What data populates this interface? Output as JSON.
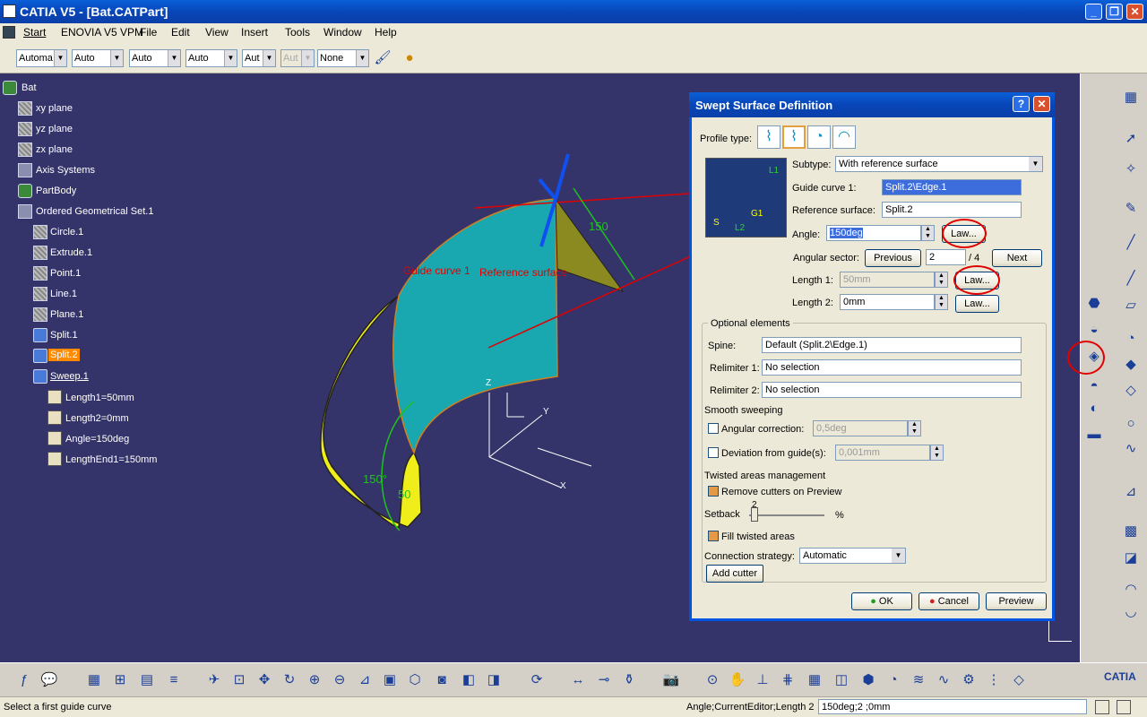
{
  "window": {
    "title": "CATIA V5 - [Bat.CATPart]"
  },
  "menu": [
    "Start",
    "ENOVIA V5 VPM",
    "File",
    "Edit",
    "View",
    "Insert",
    "Tools",
    "Window",
    "Help"
  ],
  "toolbar": {
    "combos": [
      "Automa",
      "Auto",
      "Auto",
      "Auto",
      "Aut",
      "Aut",
      "None"
    ]
  },
  "tree": {
    "root": "Bat",
    "items": [
      "xy plane",
      "yz plane",
      "zx plane",
      "Axis Systems",
      "PartBody",
      "Ordered Geometrical Set.1",
      "Circle.1",
      "Extrude.1",
      "Point.1",
      "Line.1",
      "Plane.1",
      "Split.1",
      "Split.2",
      "Sweep.1",
      "Length1=50mm",
      "Length2=0mm",
      "Angle=150deg",
      "LengthEnd1=150mm"
    ]
  },
  "viewport": {
    "annotation_150": "150",
    "label_guide": "Guide curve 1",
    "label_ref": "Reference surface",
    "angle_label": "150°",
    "len_label": "50",
    "axis_z": "Z",
    "axis_y": "Y",
    "axis_x": "X"
  },
  "dialog": {
    "title": "Swept Surface Definition",
    "help_btn": "?",
    "profile_type_label": "Profile type:",
    "subtype_label": "Subtype:",
    "subtype_value": "With reference surface",
    "guide_label": "Guide curve 1:",
    "guide_value": "Split.2\\Edge.1",
    "ref_label": "Reference surface:",
    "ref_value": "Split.2",
    "angle_label": "Angle:",
    "angle_value": "150deg",
    "law_label": "Law...",
    "sector_label": "Angular sector:",
    "previous": "Previous",
    "sector_value": "2",
    "sector_total": "/ 4",
    "next": "Next",
    "len1_label": "Length 1:",
    "len1_value": "50mm",
    "len2_label": "Length 2:",
    "len2_value": "0mm",
    "optional_title": "Optional elements",
    "spine_label": "Spine:",
    "spine_value": "Default (Split.2\\Edge.1)",
    "relim1_label": "Relimiter 1:",
    "relim1_value": "No selection",
    "relim2_label": "Relimiter 2:",
    "relim2_value": "No selection",
    "smooth_title": "Smooth sweeping",
    "angular_corr": "Angular correction:",
    "angular_corr_value": "0,5deg",
    "deviation": "Deviation from guide(s):",
    "deviation_value": "0,001mm",
    "twisted_title": "Twisted areas management",
    "remove_cutters": "Remove cutters on Preview",
    "setback_label": "Setback",
    "setback_value": "2",
    "setback_unit": "%",
    "fill_twisted": "Fill twisted areas",
    "conn_label": "Connection strategy:",
    "conn_value": "Automatic",
    "add_cutter": "Add cutter",
    "ok": "OK",
    "cancel": "Cancel",
    "preview": "Preview",
    "thumb_l1": "L1",
    "thumb_g1": "G1",
    "thumb_l2": "L2",
    "thumb_s": "S"
  },
  "status": {
    "left": "Select a first guide curve",
    "mid": "Angle;CurrentEditor;Length 2",
    "field": "150deg;2 ;0mm"
  },
  "brand": "CATIA"
}
